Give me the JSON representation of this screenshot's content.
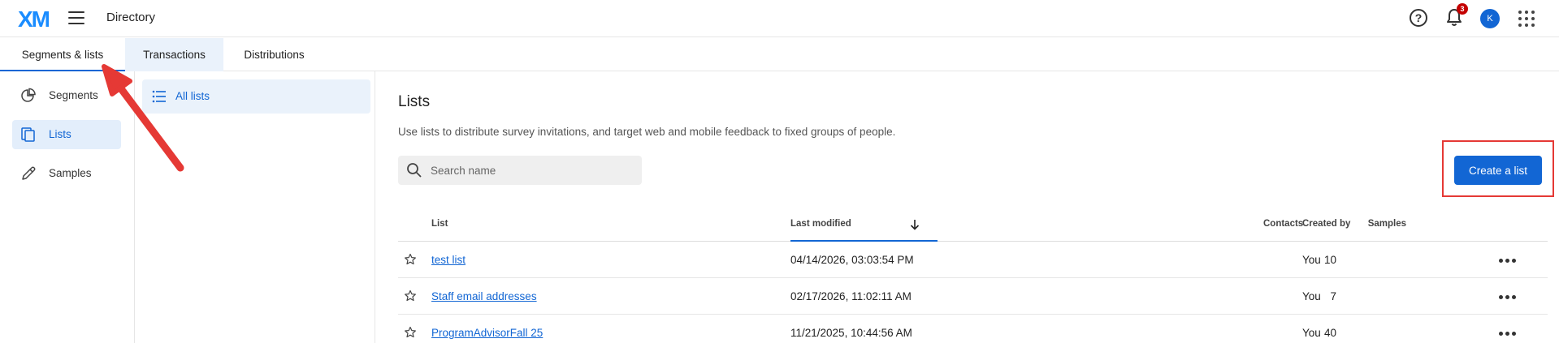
{
  "header": {
    "logo": "XM",
    "title": "Directory",
    "help_icon": "question-circle-icon",
    "notification_count": "3",
    "avatar_initial": "K"
  },
  "tabs": [
    {
      "label": "Segments & lists",
      "active": true
    },
    {
      "label": "Transactions",
      "active": false
    },
    {
      "label": "Distributions",
      "active": false
    }
  ],
  "sidebar": {
    "items": [
      {
        "label": "Segments",
        "icon": "pie-chart-icon"
      },
      {
        "label": "Lists",
        "icon": "lists-icon",
        "active": true
      },
      {
        "label": "Samples",
        "icon": "pipette-icon"
      }
    ]
  },
  "subnav": {
    "items": [
      {
        "label": "All lists",
        "icon": "list-icon",
        "active": true
      }
    ]
  },
  "main": {
    "title": "Lists",
    "description": "Use lists to distribute survey invitations, and target web and mobile feedback to fixed groups of people.",
    "search_placeholder": "Search name",
    "create_button": "Create a list"
  },
  "table": {
    "columns": {
      "list": "List",
      "last_modified": "Last modified",
      "contacts": "Contacts",
      "samples": "Samples",
      "created_by": "Created by"
    },
    "rows": [
      {
        "name": "test list",
        "last_modified": "04/14/2026, 03:03:54 PM",
        "contacts": "10",
        "created_by": "You"
      },
      {
        "name": "Staff email addresses",
        "last_modified": "02/17/2026, 11:02:11 AM",
        "contacts": "7",
        "created_by": "You"
      },
      {
        "name": "ProgramAdvisorFall 25",
        "last_modified": "11/21/2025, 10:44:56 AM",
        "contacts": "40",
        "created_by": "You"
      }
    ]
  },
  "colors": {
    "accent": "#1266d4",
    "annotation": "#e53935",
    "badge": "#c40000"
  }
}
